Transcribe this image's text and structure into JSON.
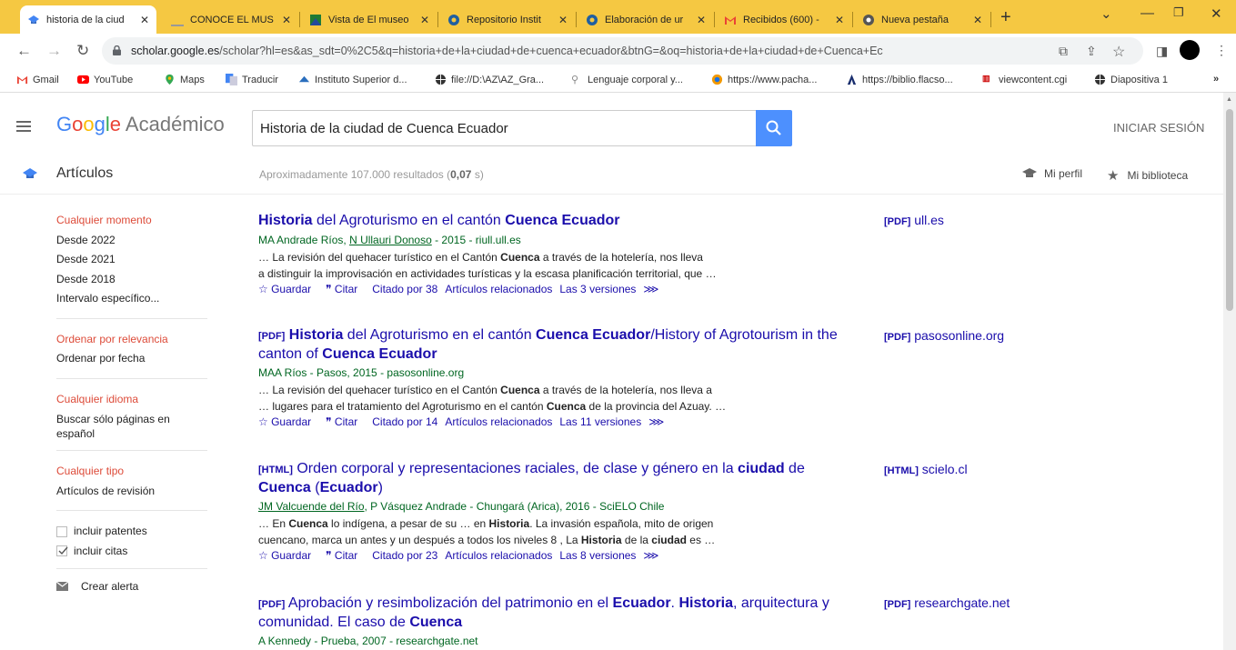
{
  "tabs": [
    {
      "title": "historia de la ciud",
      "icon": "scholar-cap-icon",
      "active": true
    },
    {
      "title": "CONOCE EL MUS",
      "icon": "page-icon"
    },
    {
      "title": "Vista de El museo",
      "icon": "flag-icon"
    },
    {
      "title": "Repositorio Instit",
      "icon": "repository-icon"
    },
    {
      "title": "Elaboración de ur",
      "icon": "repository-icon"
    },
    {
      "title": "Recibidos (600) -",
      "icon": "gmail-icon"
    },
    {
      "title": "Nueva pestaña",
      "icon": "chrome-icon"
    }
  ],
  "address_bar": {
    "domain": "scholar.google.es",
    "path": "/scholar?hl=es&as_sdt=0%2C5&q=historia+de+la+ciudad+de+cuenca+ecuador&btnG=&oq=historia+de+la+ciudad+de+Cuenca+Ec"
  },
  "bookmarks": [
    {
      "label": "Gmail",
      "icon": "gmail-icon"
    },
    {
      "label": "YouTube",
      "icon": "youtube-icon"
    },
    {
      "label": "Maps",
      "icon": "maps-icon"
    },
    {
      "label": "Traducir",
      "icon": "translate-icon"
    },
    {
      "label": "Instituto Superior d...",
      "icon": "institute-icon"
    },
    {
      "label": "file://D:\\AZ\\AZ_Gra...",
      "icon": "globe-icon"
    },
    {
      "label": "Lenguaje corporal y...",
      "icon": "link-icon"
    },
    {
      "label": "https://www.pacha...",
      "icon": "site-icon"
    },
    {
      "label": "https://biblio.flacso...",
      "icon": "flacso-icon"
    },
    {
      "label": "viewcontent.cgi",
      "icon": "viewcontent-icon"
    },
    {
      "label": "Diapositiva 1",
      "icon": "globe-icon"
    }
  ],
  "header": {
    "logo_parts": [
      "G",
      "o",
      "o",
      "g",
      "l",
      "e"
    ],
    "logo_suffix": "Académico",
    "search_value": "Historia de la ciudad de Cuenca Ecuador",
    "signin_label": "INICIAR SESIÓN"
  },
  "subheader": {
    "section": "Artículos",
    "results_prefix": "Aproximadamente 107.000 resultados (",
    "results_time": "0,07",
    "results_suffix": " s)",
    "profile_label": "Mi perfil",
    "library_label": "Mi biblioteca"
  },
  "sidebar": {
    "time": [
      "Cualquier momento",
      "Desde 2022",
      "Desde 2021",
      "Desde 2018",
      "Intervalo específico..."
    ],
    "sort": [
      "Ordenar por relevancia",
      "Ordenar por fecha"
    ],
    "language": [
      "Cualquier idioma",
      "Buscar sólo páginas en español"
    ],
    "type": [
      "Cualquier tipo",
      "Artículos de revisión"
    ],
    "include_patents": "incluir patentes",
    "include_patents_checked": false,
    "include_citations": "incluir citas",
    "include_citations_checked": true,
    "create_alert": "Crear alerta"
  },
  "results": [
    {
      "type": "",
      "title_html": "<b>Historia</b> del Agroturismo en el cantón <b>Cuenca Ecuador</b>",
      "authors_html": "MA Andrade Ríos, <u>N Ullauri Donoso</u> - 2015 - riull.ull.es",
      "snippet_html": "… La revisión del quehacer turístico en el Cantón <b>Cuenca</b> a través de la hotelería, nos lleva<br>a distinguir la improvisación en actividades turísticas y la escasa planificación territorial, que …",
      "save": "Guardar",
      "cite": "Citar",
      "cited_by": "Citado por 38",
      "related": "Artículos relacionados",
      "versions": "Las 3 versiones",
      "side_type": "[PDF]",
      "side_source": "ull.es"
    },
    {
      "type": "[PDF]",
      "title_html": "<b>Historia</b> del Agroturismo en el cantón <b>Cuenca Ecuador</b>/History of Agrotourism in the canton of <b>Cuenca Ecuador</b>",
      "authors_html": "MAA Ríos - Pasos, 2015 - pasosonline.org",
      "snippet_html": "… La revisión del quehacer turístico en el Cantón <b>Cuenca</b> a través de la hotelería, nos lleva a<br>… lugares para el tratamiento del Agroturismo en el cantón <b>Cuenca</b> de la provincia del Azuay. …",
      "save": "Guardar",
      "cite": "Citar",
      "cited_by": "Citado por 14",
      "related": "Artículos relacionados",
      "versions": "Las 11 versiones",
      "side_type": "[PDF]",
      "side_source": "pasosonline.org"
    },
    {
      "type": "[HTML]",
      "title_html": "Orden corporal y representaciones raciales, de clase y género en la <b>ciudad</b> de <b>Cuenca</b> (<b>Ecuador</b>)",
      "authors_html": "<u>JM Valcuende del Río</u>, P Vásquez Andrade - Chungará (Arica), 2016 - SciELO Chile",
      "snippet_html": "… En <b>Cuenca</b> lo indígena, a pesar de su … en <b>Historia</b>. La invasión española, mito de origen<br>cuencano, marca un antes y un después a todos los niveles 8 , La <b>Historia</b> de la <b>ciudad</b> es …",
      "save": "Guardar",
      "cite": "Citar",
      "cited_by": "Citado por 23",
      "related": "Artículos relacionados",
      "versions": "Las 8 versiones",
      "side_type": "[HTML]",
      "side_source": "scielo.cl"
    },
    {
      "type": "[PDF]",
      "title_html": "Aprobación y resimbolización del patrimonio en el <b>Ecuador</b>. <b>Historia</b>, arquitectura y comunidad. El caso de <b>Cuenca</b>",
      "authors_html": "A Kennedy - Prueba, 2007 - researchgate.net",
      "snippet_html": "",
      "save": "",
      "cite": "",
      "cited_by": "",
      "related": "",
      "versions": "",
      "side_type": "[PDF]",
      "side_source": "researchgate.net"
    }
  ]
}
